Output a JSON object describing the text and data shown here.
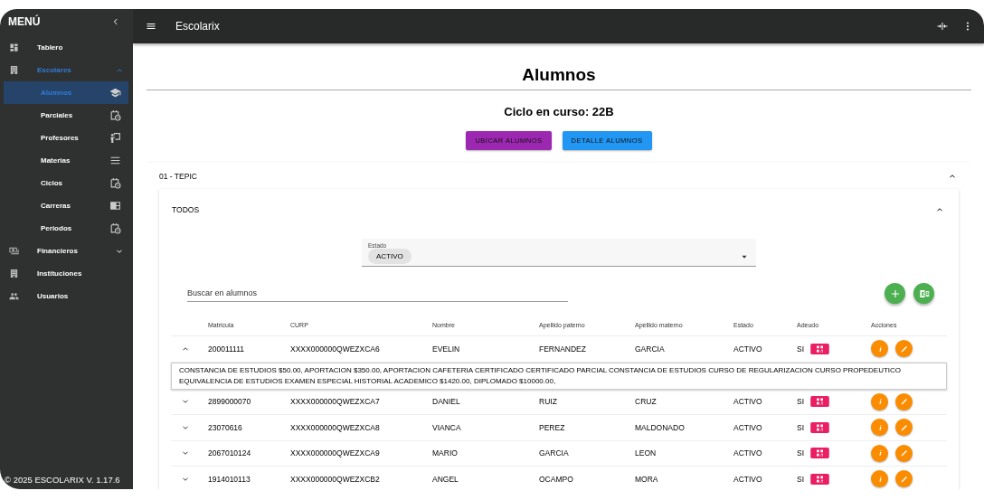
{
  "sidebar": {
    "title": "MENÚ",
    "items": [
      {
        "label": "Tablero",
        "selected": false
      },
      {
        "label": "Escolares",
        "selected": true,
        "expanded": true,
        "children": [
          {
            "label": "Alumnos",
            "selected": true
          },
          {
            "label": "Parciales",
            "selected": false
          },
          {
            "label": "Profesores",
            "selected": false
          },
          {
            "label": "Materias",
            "selected": false
          },
          {
            "label": "Ciclos",
            "selected": false
          },
          {
            "label": "Carreras",
            "selected": false
          },
          {
            "label": "Periodos",
            "selected": false
          }
        ]
      },
      {
        "label": "Financieros",
        "selected": false,
        "expanded": false
      },
      {
        "label": "Instituciones",
        "selected": false
      },
      {
        "label": "Usuarios",
        "selected": false
      }
    ],
    "footer": "© 2025 ESCOLARIX V. 1.17.6"
  },
  "topbar": {
    "title": "Escolarix"
  },
  "page": {
    "title": "Alumnos",
    "subtitle": "Ciclo en curso: 22B",
    "buttons": [
      {
        "label": "UBICAR ALUMNOS",
        "color": "#9c27b0"
      },
      {
        "label": "DETALLE ALUMNOS",
        "color": "#2196f3"
      }
    ],
    "panel": {
      "title": "01 - TEPIC",
      "expanded": true,
      "group": {
        "title": "TODOS",
        "expanded": true,
        "filter": {
          "label": "Estado",
          "chip": "ACTIVO"
        },
        "search": {
          "placeholder": "Buscar en alumnos"
        },
        "table": {
          "columns": [
            "Matricula",
            "CURP",
            "Nombre",
            "Apellido paterno",
            "Apellido materno",
            "Estado",
            "Adeudo",
            "Acciones"
          ],
          "rows": [
            {
              "expanded": true,
              "cells": [
                "200011111",
                "XXXX000000QWEZXCA6",
                "EVELIN",
                "FERNANDEZ",
                "GARCIA",
                "ACTIVO",
                "SI"
              ],
              "detail": "CONSTANCIA DE ESTUDIOS $50.00, APORTACION $350.00, APORTACION CAFETERIA CERTIFICADO CERTIFICADO PARCIAL CONSTANCIA DE ESTUDIOS CURSO DE REGULARIZACION CURSO PROPEDEUTICO EQUIVALENCIA DE ESTUDIOS EXAMEN ESPECIAL HISTORIAL ACADEMICO $1420.00, DIPLOMADO $10000.00,"
            },
            {
              "expanded": false,
              "cells": [
                "2899000070",
                "XXXX000000QWEZXCA7",
                "DANIEL",
                "RUIZ",
                "CRUZ",
                "ACTIVO",
                "SI"
              ]
            },
            {
              "expanded": false,
              "cells": [
                "23070616",
                "XXXX000000QWEZXCA8",
                "VIANCA",
                "PEREZ",
                "MALDONADO",
                "ACTIVO",
                "SI"
              ]
            },
            {
              "expanded": false,
              "cells": [
                "2067010124",
                "XXXX000000QWEZXCA9",
                "MARIO",
                "GARCIA",
                "LEON",
                "ACTIVO",
                "SI"
              ]
            },
            {
              "expanded": false,
              "cells": [
                "1914010113",
                "XXXX000000QWEZXCB2",
                "ANGEL",
                "OCAMPO",
                "MORA",
                "ACTIVO",
                "SI"
              ]
            }
          ]
        }
      }
    }
  }
}
